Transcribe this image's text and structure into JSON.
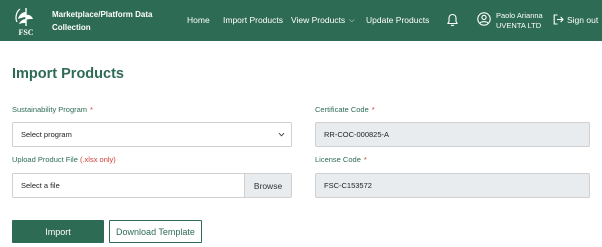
{
  "header": {
    "logo_text": "FSC",
    "app_title_line1": "Marketplace/Platform Data",
    "app_title_line2": "Collection",
    "nav": {
      "home": "Home",
      "import_products": "Import Products",
      "view_products": "View Products",
      "update_products": "Update Products"
    },
    "icons": {
      "bell": "bell-icon",
      "user": "user-icon",
      "signout": "sign-out-icon"
    },
    "user": {
      "name": "Paolo Arianna",
      "company": "UVENTA LTD"
    },
    "signout_label": "Sign out"
  },
  "page": {
    "title": "Import Products"
  },
  "form": {
    "program": {
      "label": "Sustainability Program",
      "required_mark": "*",
      "selected": "Select program"
    },
    "upload": {
      "label": "Upload Product File",
      "hint": "(.xlsx only)",
      "file_text": "Select a file",
      "browse_label": "Browse"
    },
    "certificate": {
      "label": "Certificate Code",
      "required_mark": "*",
      "value": "RR-COC-000825-A"
    },
    "license": {
      "label": "License Code",
      "required_mark": "*",
      "value": "FSC-C153572"
    }
  },
  "actions": {
    "import_label": "Import",
    "template_label": "Download Template"
  },
  "colors": {
    "brand": "#2e6b55",
    "required": "#d23b3b",
    "readonly_bg": "#e9ecef"
  }
}
